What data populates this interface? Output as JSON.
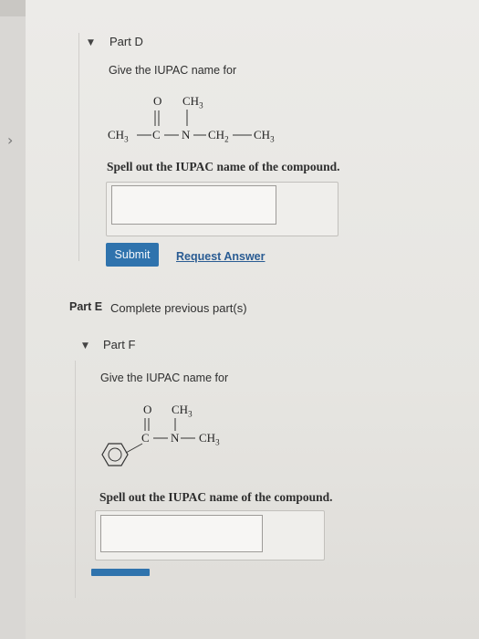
{
  "side_nav": {
    "chevron": "›"
  },
  "part_d": {
    "collapse_icon": "▼",
    "title": "Part D",
    "prompt": "Give the IUPAC name for",
    "formula": {
      "o_top": "O",
      "ch3_top": "CH3",
      "left_ch3": "CH3",
      "c": "C",
      "n": "N",
      "ch2": "CH2",
      "right_ch3": "CH3"
    },
    "instruction": "Spell out the IUPAC name of the compound.",
    "answer_value": "",
    "submit_label": "Submit",
    "request_answer_label": "Request Answer"
  },
  "part_e": {
    "label": "Part E",
    "status": "Complete previous part(s)"
  },
  "part_f": {
    "collapse_icon": "▼",
    "title": "Part F",
    "prompt": "Give the IUPAC name for",
    "formula": {
      "o_top": "O",
      "ch3_top": "CH3",
      "c": "C",
      "n": "N",
      "right_ch3": "CH3"
    },
    "instruction": "Spell out the IUPAC name of the compound.",
    "answer_value": ""
  }
}
